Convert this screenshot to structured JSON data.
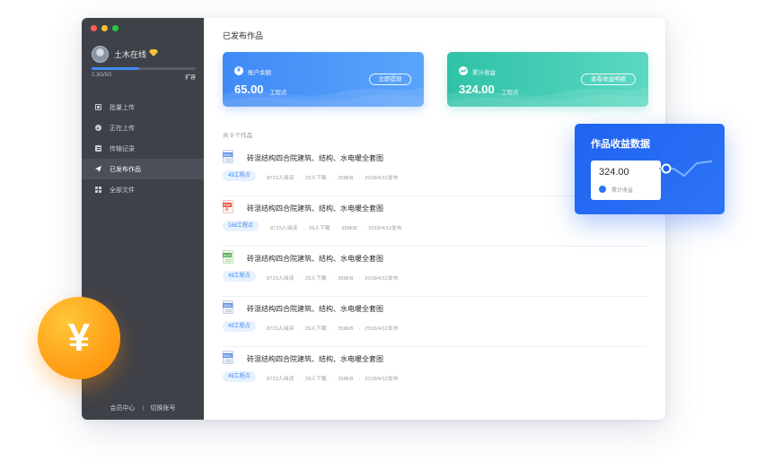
{
  "sidebar": {
    "username": "土木在线",
    "storage_text": "2.3G/5G",
    "storage_fraction": 0.46,
    "expand_label": "扩容",
    "nav": [
      {
        "label": "批量上传",
        "icon": "copy-icon"
      },
      {
        "label": "正在上传",
        "icon": "upload-icon"
      },
      {
        "label": "传输记录",
        "icon": "record-icon"
      },
      {
        "label": "已发布作品",
        "icon": "send-icon"
      },
      {
        "label": "全部文件",
        "icon": "grid-icon"
      }
    ],
    "active_index": 3,
    "footer_member": "会员中心",
    "footer_switch": "切换账号"
  },
  "main": {
    "title": "已发布作品",
    "balance_card": {
      "label": "账户余额",
      "value": "65.00",
      "unit": "工程点",
      "button": "立即提现",
      "icon": "yen-icon",
      "color": "#3f8af6"
    },
    "earnings_card": {
      "label": "累计收益",
      "value": "324.00",
      "unit": "工程点",
      "button": "查看收益明细",
      "icon": "chart-icon",
      "color": "#2fc2a7"
    },
    "count_label": "共 9 个作品",
    "works": [
      {
        "type": "doc",
        "title": "砖混结构四合院建筑、结构、水电暖全套图",
        "price": "49工程点",
        "reads": "8723人阅读",
        "downloads": "29人下载",
        "size": "358KB",
        "date": "2018/4/12发布"
      },
      {
        "type": "pdf",
        "title": "砖混结构四合院建筑、结构、水电暖全套图",
        "price": "168工程点",
        "reads": "8723人阅读",
        "downloads": "29人下载",
        "size": "358KB",
        "date": "2018/4/12发布"
      },
      {
        "type": "xls",
        "title": "砖混结构四合院建筑、结构、水电暖全套图",
        "price": "49工程点",
        "reads": "8723人阅读",
        "downloads": "29人下载",
        "size": "358KB",
        "date": "2018/4/12发布"
      },
      {
        "type": "doc",
        "title": "砖混结构四合院建筑、结构、水电暖全套图",
        "price": "49工程点",
        "reads": "8723人阅读",
        "downloads": "29人下载",
        "size": "358KB",
        "date": "2018/4/12发布"
      },
      {
        "type": "doc",
        "title": "砖混结构四合院建筑、结构、水电暖全套图",
        "price": "49工程点",
        "reads": "8723人阅读",
        "downloads": "29人下载",
        "size": "358KB",
        "date": "2018/4/12发布"
      }
    ]
  },
  "popup": {
    "title": "作品收益数据",
    "value": "324.00",
    "sub_label": "累计收益"
  },
  "coin": {
    "symbol": "¥",
    "color": "#ffa31a"
  }
}
